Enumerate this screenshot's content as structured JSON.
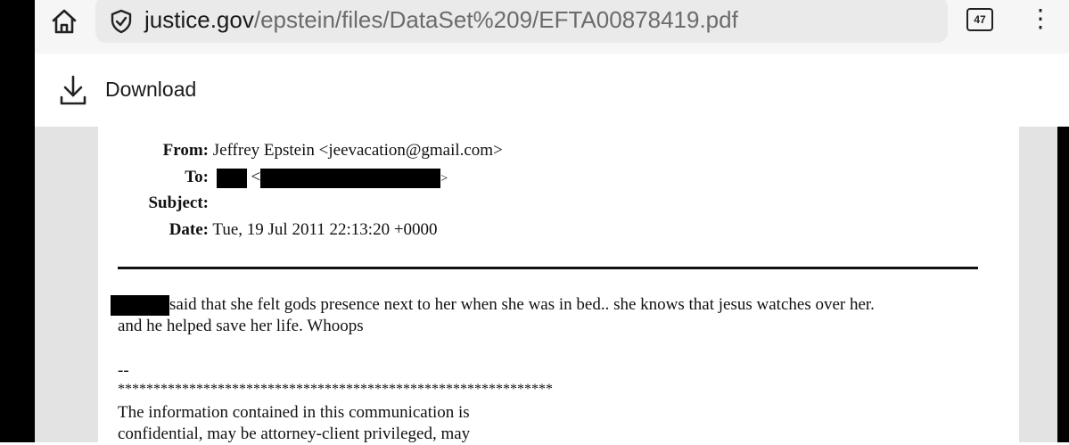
{
  "browser": {
    "url_domain": "justice.gov",
    "url_path": "/epstein/files/DataSet%209/EFTA00878419.pdf",
    "tab_count": "47",
    "home_icon": "home-icon",
    "security_icon": "shield-check-icon",
    "menu_icon": "more-vert-icon"
  },
  "download_bar": {
    "label": "Download",
    "icon": "download-icon"
  },
  "email": {
    "from_label": "From:",
    "from_value": "Jeffrey Epstein <jeevacation@gmail.com>",
    "to_label": "To:",
    "to_lt": "<",
    "to_gt": ">",
    "subject_label": "Subject:",
    "date_label": "Date:",
    "date_value": "Tue, 19 Jul 2011 22:13:20 +0000",
    "body_line1": "said that she felt gods presence next to her when she was in bed..  she knows that jesus watches over her.",
    "body_line2": "and he helped save her life.     Whoops",
    "sig_dashes": "--",
    "sig_stars": "*************************************************************",
    "disclaimer_line1": "The information contained in this communication is",
    "disclaimer_line2": "confidential, may be attorney-client privileged, may"
  }
}
